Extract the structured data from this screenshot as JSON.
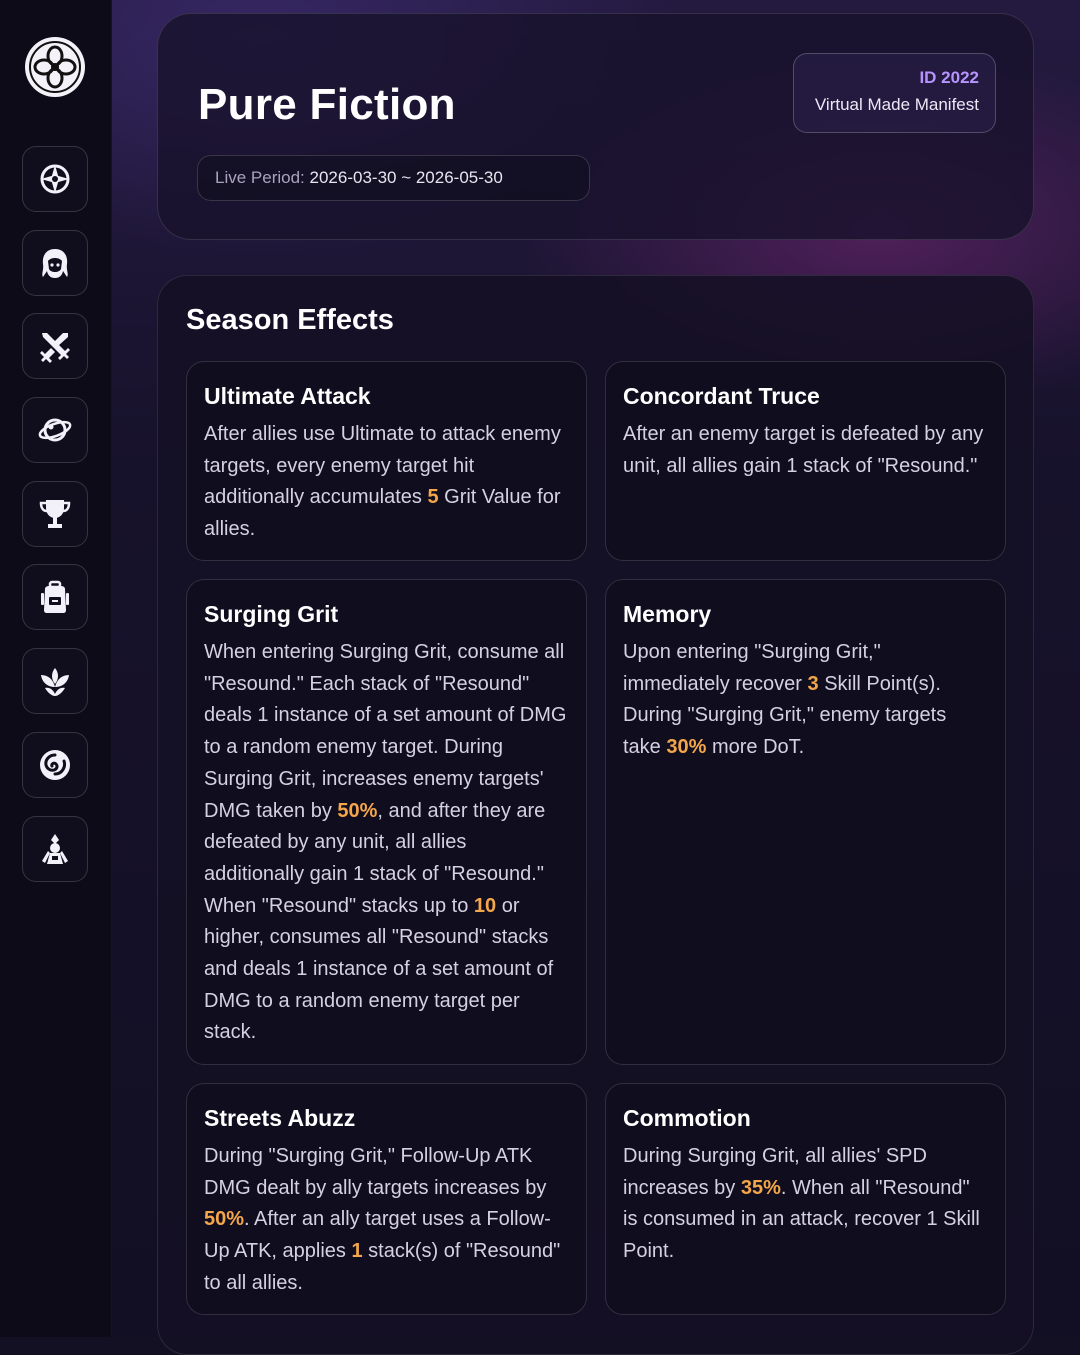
{
  "header": {
    "title": "Pure Fiction",
    "period_label": "Live Period:",
    "period_value": "2026-03-30 ~ 2026-05-30",
    "id_label": "ID 2022",
    "name": "Virtual Made Manifest"
  },
  "sidebar": {
    "items": [
      {
        "name": "compass-icon"
      },
      {
        "name": "character-icon"
      },
      {
        "name": "crossed-swords-icon"
      },
      {
        "name": "planet-icon"
      },
      {
        "name": "trophy-icon"
      },
      {
        "name": "backpack-icon"
      },
      {
        "name": "lotus-icon"
      },
      {
        "name": "swirl-icon"
      },
      {
        "name": "figure-icon"
      }
    ]
  },
  "effects": {
    "title": "Season Effects",
    "items": [
      {
        "name": "Ultimate Attack",
        "segments": [
          {
            "text": "After allies use Ultimate to attack enemy targets, every enemy target hit additionally accumulates "
          },
          {
            "text": "5",
            "hl": true
          },
          {
            "text": " Grit Value for allies."
          }
        ]
      },
      {
        "name": "Concordant Truce",
        "segments": [
          {
            "text": "After an enemy target is defeated by any unit, all allies gain 1 stack of \"Resound.\""
          }
        ]
      },
      {
        "name": "Surging Grit",
        "segments": [
          {
            "text": "When entering Surging Grit, consume all \"Resound.\" Each stack of \"Resound\" deals 1 instance of a set amount of DMG to a random enemy target. During Surging Grit, increases enemy targets' DMG taken by "
          },
          {
            "text": "50%",
            "hl": true
          },
          {
            "text": ", and after they are defeated by any unit, all allies additionally gain 1 stack of \"Resound.\" When \"Resound\" stacks up to "
          },
          {
            "text": "10",
            "hl": true
          },
          {
            "text": " or higher, consumes all \"Resound\" stacks and deals 1 instance of a set amount of DMG to a random enemy target per stack."
          }
        ]
      },
      {
        "name": "Memory",
        "segments": [
          {
            "text": "Upon entering \"Surging Grit,\" immediately recover "
          },
          {
            "text": "3",
            "hl": true
          },
          {
            "text": " Skill Point(s). During \"Surging Grit,\" enemy targets take "
          },
          {
            "text": "30%",
            "hl": true
          },
          {
            "text": " more DoT."
          }
        ]
      },
      {
        "name": "Streets Abuzz",
        "segments": [
          {
            "text": "During \"Surging Grit,\" Follow-Up ATK DMG dealt by ally targets increases by "
          },
          {
            "text": "50%",
            "hl": true
          },
          {
            "text": ". After an ally target uses a Follow-Up ATK, applies "
          },
          {
            "text": "1",
            "hl": true
          },
          {
            "text": " stack(s) of \"Resound\" to all allies."
          }
        ]
      },
      {
        "name": "Commotion",
        "segments": [
          {
            "text": "During Surging Grit, all allies' SPD increases by "
          },
          {
            "text": "35%",
            "hl": true
          },
          {
            "text": ". When all \"Resound\" is consumed in an attack, recover 1 Skill Point."
          }
        ]
      }
    ]
  },
  "colors": {
    "highlight": "#f3a64a",
    "id_accent": "#b694ff"
  }
}
